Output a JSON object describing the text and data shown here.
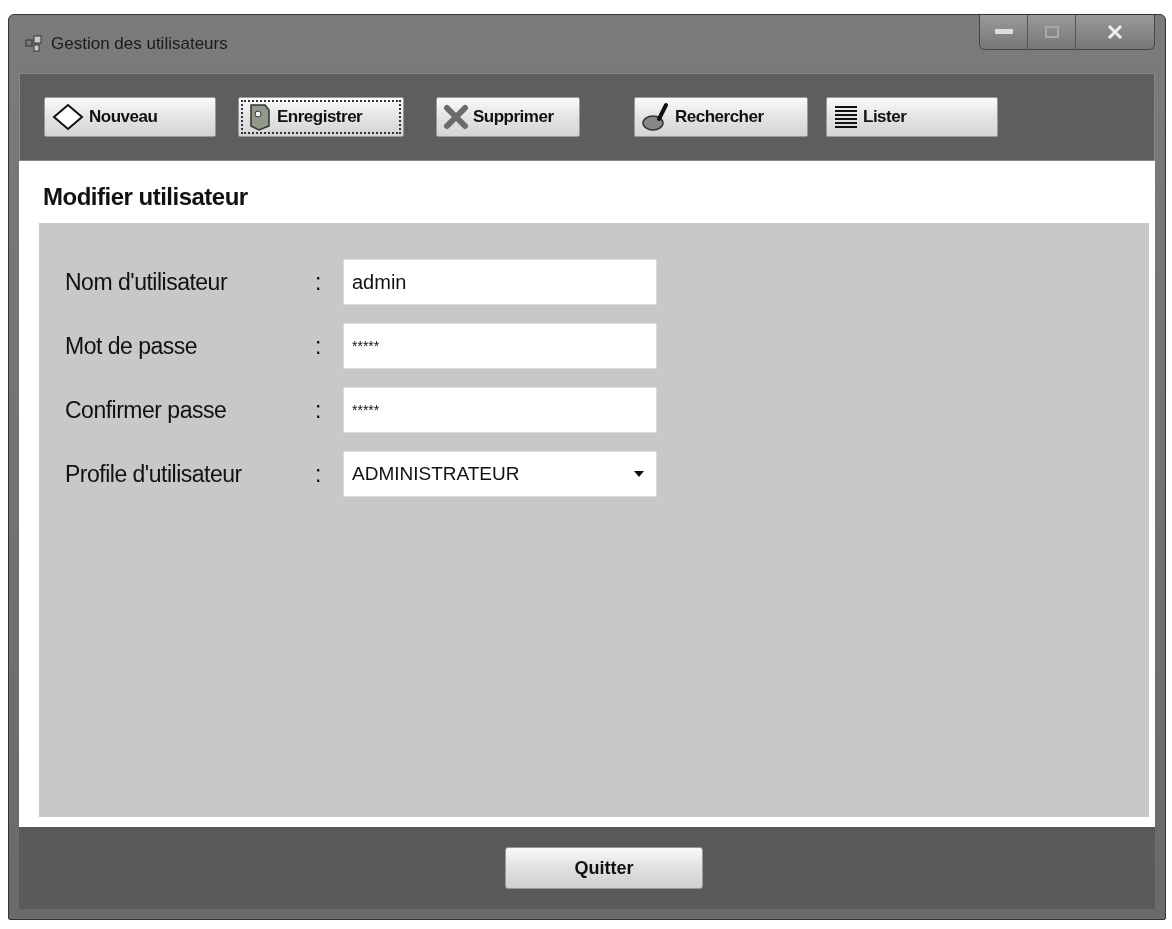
{
  "window": {
    "title": "Gestion des utilisateurs"
  },
  "toolbar": [
    {
      "label": "Nouveau",
      "kind": "new",
      "focused": false
    },
    {
      "label": "Enregistrer",
      "kind": "save",
      "focused": true
    },
    {
      "label": "Supprimer",
      "kind": "delete",
      "focused": false
    },
    {
      "label": "Rechercher",
      "kind": "search",
      "focused": false
    },
    {
      "label": "Lister",
      "kind": "list",
      "focused": false
    }
  ],
  "section_title": "Modifier utilisateur",
  "form": [
    {
      "label": "Nom d'utilisateur",
      "separator": ":",
      "kind": "text",
      "value": "admin"
    },
    {
      "label": "Mot de passe",
      "separator": ":",
      "kind": "password",
      "value": "*****"
    },
    {
      "label": "Confirmer passe",
      "separator": ":",
      "kind": "password",
      "value": "*****"
    },
    {
      "label": "Profile d'utilisateur",
      "separator": ":",
      "kind": "dropdown",
      "value": "ADMINISTRATEUR"
    }
  ],
  "quit_button": {
    "label": "Quitter"
  }
}
